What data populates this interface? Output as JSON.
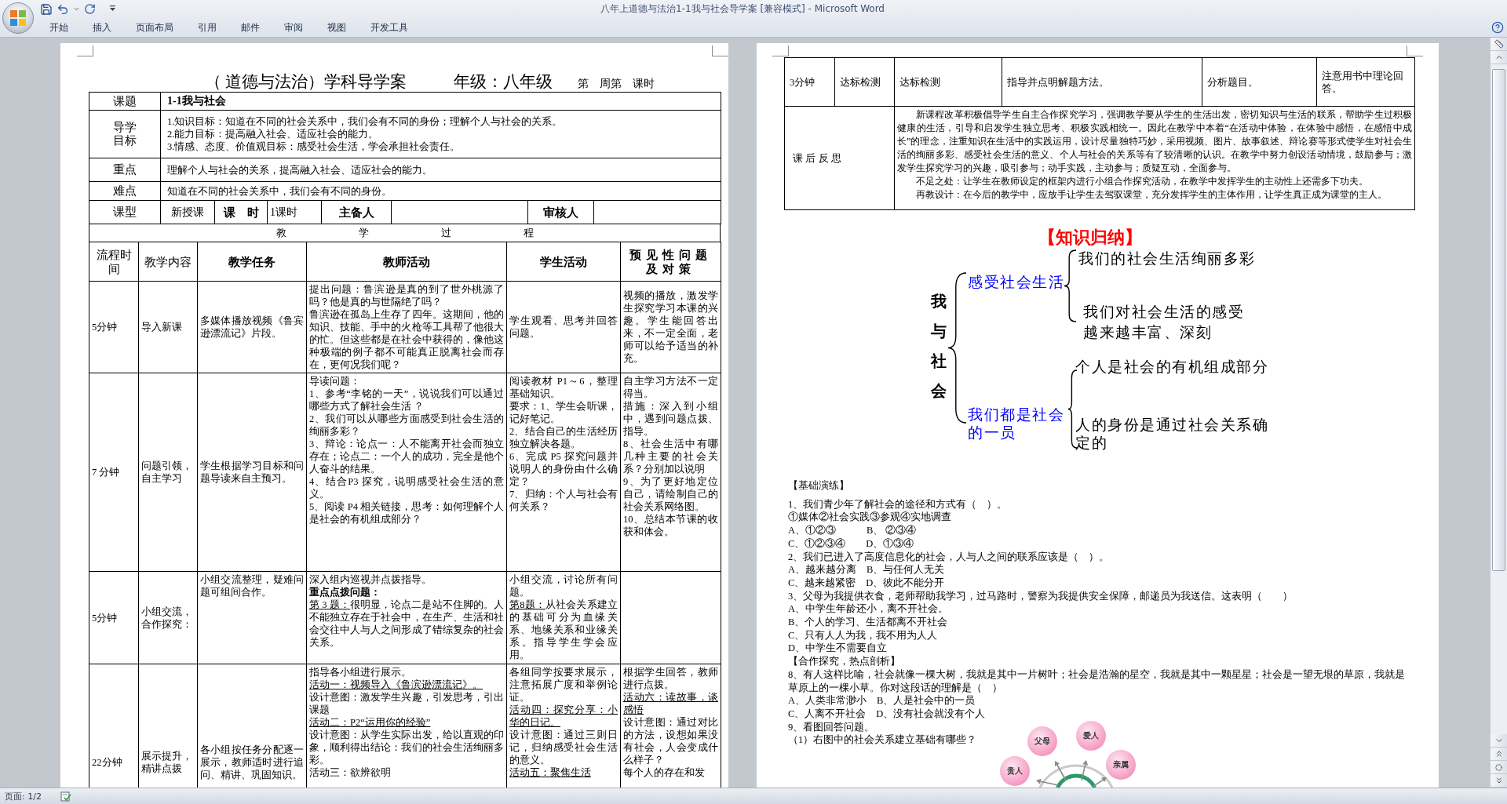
{
  "window": {
    "title": "八年上道德与法治1-1我与社会导学案 [兼容模式] - Microsoft Word"
  },
  "ribbon": {
    "tabs": [
      {
        "label": "开始",
        "selected": false
      },
      {
        "label": "插入",
        "selected": false
      },
      {
        "label": "页面布局",
        "selected": false
      },
      {
        "label": "引用",
        "selected": false
      },
      {
        "label": "邮件",
        "selected": false
      },
      {
        "label": "审阅",
        "selected": false
      },
      {
        "label": "视图",
        "selected": false
      },
      {
        "label": "开发工具",
        "selected": false
      }
    ]
  },
  "left_page": {
    "heading": {
      "title": "（ 道德与法治）学科导学案",
      "grade": "年级：八年级",
      "period": "第　周第　课时"
    },
    "info_rows": [
      {
        "label": "课题",
        "kind": "topic",
        "lines": [
          "1-1我与社会"
        ]
      },
      {
        "label": "导学目标",
        "kind": "list",
        "lines": [
          "1.知识目标：知道在不同的社会关系中，我们会有不同的身份；理解个人与社会的关系。",
          "2.能力目标：提高融入社会、适应社会的能力。",
          "3.情感、态度、价值观目标：感受社会生活，学会承担社会责任。"
        ]
      },
      {
        "label": "重点",
        "kind": "list",
        "lines": [
          "理解个人与社会的关系，提高融入社会、适应社会的能力。"
        ]
      },
      {
        "label": "难点",
        "kind": "list",
        "lines": [
          "知道在不同的社会关系中，我们会有不同的身份。"
        ]
      }
    ],
    "lesson_type": {
      "label": "课型",
      "value": "新授课"
    },
    "staff_fields": [
      {
        "label": "课　时",
        "value": "1课时"
      },
      {
        "label": "主备人"
      },
      {
        "label": "审核人"
      }
    ],
    "process_title": "教学过程",
    "process": {
      "columns": [
        "流程时间",
        "教学内容",
        "教学任务",
        "教师活动",
        "学生活动",
        "预见性问题及对策"
      ],
      "rows": [
        {
          "time": "5分钟",
          "content": "导入新课",
          "task": [
            "多媒体播放视频《鲁宾逊漂流记》片段。"
          ],
          "teacher": [
            "提出问题：鲁滨逊是真的到了世外桃源了吗？他是真的与世隔绝了吗？",
            "鲁滨逊在孤岛上生存了四年。这期间，他的知识、技能、手中的火枪等工具帮了他很大的忙。但这些都是在社会中获得的，像他这种极端的例子都不可能真正脱离社会而存在，更何况我们呢？"
          ],
          "student": [
            "学生观看、思考并回答问题。"
          ],
          "strategy": [
            "视频的播放，激发学生探究学习本课的兴趣。学生能回答出来，不一定全面，老师可以给予适当的补充。"
          ]
        },
        {
          "time": "7 分钟",
          "content": "问题引领，自主学习",
          "task": [
            "学生根据学习目标和问题导读来自主预习。"
          ],
          "teacher": [
            "导读问题：",
            "1、参考“李铭的一天”，说说我们可以通过哪些方式了解社会生活 ？",
            "2、我们可以从哪些方面感受到社会生活的绚丽多彩？",
            "3、辩论：论点一：人不能离开社会而独立存在；论点二：一个人的成功，完全是他个人奋斗的结果。",
            "4、结合P3 探究，说明感受社会生活的意义。",
            "5、阅读 P4 相关链接，思考：如何理解个人是社会的有机组成部分？"
          ],
          "student": [
            "阅读教材 P1～6，整理基础知识。",
            "要求：1、学生会听课，记好笔记。",
            "2、结合自己的生活经历独立解决各题。",
            "6、完成 P5 探究问题并说明人的身份由什么确定？",
            "7、归纳：个人与社会有何关系？"
          ],
          "strategy": [
            "自主学习方法不一定得当。",
            "措施：深入到小组中，遇到问题点拨、指导。",
            "8、社会生活中有哪几种主要的社会关系？分别加以说明",
            "9、为了更好地定位自己，请绘制自己的社会关系网络图。",
            "10、总结本节课的收获和体会。"
          ]
        },
        {
          "time": "5分钟",
          "content": "小组交流，合作探究：",
          "task": [
            "小组交流整理，疑难问题可组间合作。"
          ],
          "teacher": [
            "深入组内巡视并点拨指导。",
            {
              "kind": "bold",
              "text": "重点点拨问题："
            },
            {
              "kind": "lead",
              "lead": "第 3 题：",
              "text": "很明显，论点二是站不住脚的。人不能独立存在于社会中，在生产、生活和社会交往中人与人之间形成了错综复杂的社会关系。"
            }
          ],
          "student": [
            "小组交流，讨论所有问题。",
            {
              "kind": "lead",
              "lead": "第8题：",
              "text": "从社会关系建立的基础可分为血缘关系、地缘关系和业缘关系。指导学生学会应用。"
            }
          ]
        },
        {
          "time": "22分钟",
          "content": "展示提升，精讲点拨",
          "task": [
            "各小组按任务分配逐一展示，教师适时进行追问、精讲、巩固知识。"
          ],
          "teacher": [
            "指导各小组进行展示。",
            {
              "kind": "underline",
              "text": "活动一：视频导入《鲁滨逊漂流记》。"
            },
            "设计意图：激发学生兴趣，引发思考，引出课题",
            {
              "kind": "underline",
              "text": "活动二：P2“运用你的经验”"
            },
            "设计意图：从学生实际出发，给以直观的印象，顺利得出结论：我们的社会生活绚丽多彩。",
            "活动三：欲辨欲明"
          ],
          "student": [
            "各组同学按要求展示，注意拓展广度和举例论证。",
            {
              "kind": "underline",
              "text": "活动四：探究分享：小华的日记。"
            },
            "设计意图：通过三则日记，归纳感受社会生活的意义。",
            {
              "kind": "underline",
              "text": "活动五：聚焦生活"
            }
          ],
          "strategy": [
            "根据学生回答，教师进行点拨。",
            {
              "kind": "underline",
              "text": "活动六：读故事，谈感悟"
            },
            "设计意图：通过对比的方法，设想如果没有社会，人会变成什么样子？",
            "每个人的存在和发"
          ]
        }
      ]
    }
  },
  "right_page": {
    "check_row": {
      "time": "3分钟",
      "content": "达标检测",
      "task": "达标检测",
      "teacher": "指导并点明解题方法。",
      "student": "分析题目。",
      "strategy": "注意用书中理论回答。"
    },
    "reflection": {
      "label": "课 后 反 思",
      "paragraphs": [
        "新课程改革积极倡导学生自主合作探究学习，强调教学要从学生的生活出发，密切知识与生活的联系，帮助学生过积极健康的生活，引导和启发学生独立思考、积极实践相统一。因此在教学中本着“在活动中体验，在体验中感悟，在感悟中成长”的理念，注重知识在生活中的实践运用，设计尽量独特巧妙，采用视频、图片、故事叙述、辩论赛等形式使学生对社会生活的绚丽多彩、感受社会生活的意义、个人与社会的关系等有了较清晰的认识。在教学中努力创设活动情境，鼓励参与；激发学生探究学习的兴趣，吸引参与；动手实践，主动参与；质疑互动，全面参与。",
        "不足之处：让学生在教师设定的框架内进行小组合作探究活动，在教学中发挥学生的主动性上还需多下功夫。",
        "再教设计：在今后的教学中，应放手让学生去驾驭课堂，充分发挥学生的主体作用，让学生真正成为课堂的主人。"
      ]
    },
    "knowledge_map": {
      "title": "【知识归纳】",
      "root": "我与社会",
      "branches": [
        {
          "label": "感受社会生活",
          "children": [
            "我们的社会生活绚丽多彩",
            "我们对社会生活的感受越来越丰富、深刻"
          ]
        },
        {
          "label": "我们都是社会的一员",
          "children": [
            "个人是社会的有机组成部分",
            "人的身份是通过社会关系确定的"
          ]
        }
      ]
    },
    "exercises": [
      "【基础演练】",
      "1、我们青少年了解社会的途径和方式有（　）。",
      "①媒体②社会实践③参观④实地调查",
      "A、①②③　　　B、 ②③④",
      "C、①②③④　　D、①③④",
      "2、我们已进入了高度信息化的社会，人与人之间的联系应该是（　）。",
      "A、越来越分离　B、与任何人无关",
      "C、越来越紧密　D、彼此不能分开",
      "3、父母为我提供衣食，老师帮助我学习，过马路时，警察为我提供安全保障，邮递员为我送信。这表明（　　）",
      "A、中学生年龄还小，离不开社会。",
      "B、个人的学习、生活都离不开社会",
      "C、只有人人为我，我不用为人人",
      "D、中学生不需要自立",
      "【合作探究，热点剖析】",
      "8、有人这样比喻，社会就像一棵大树，我就是其中一片树叶；社会是浩瀚的星空，我就是其中一颗星星；社会是一望无垠的草原，我就是草原上的一棵小草。你对这段话的理解是（　）",
      "A、人类非常渺小　B、人是社会中的一员",
      "C、人离不开社会　D、没有社会就没有个人",
      "9、看图回答问题。",
      "（1）右图中的社会关系建立基础有哪些？"
    ],
    "relation_figure": {
      "labels": [
        "父母",
        "爱人",
        "亲属",
        "贵人"
      ]
    }
  },
  "status_bar": {
    "page": "页面: 1/2"
  }
}
